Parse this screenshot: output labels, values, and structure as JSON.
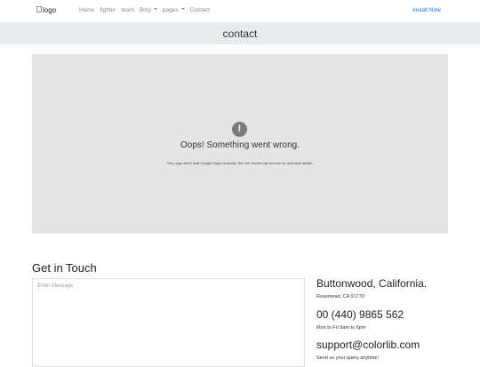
{
  "navbar": {
    "logo_alt": "logo",
    "items": [
      {
        "label": "Home"
      },
      {
        "label": "fighter"
      },
      {
        "label": "team"
      },
      {
        "label": "Blog",
        "dropdown": true
      },
      {
        "label": "pages",
        "dropdown": true
      },
      {
        "label": "Contact"
      }
    ],
    "install_label": "Install Now",
    "install_color": "#1a73e8"
  },
  "page_title": "contact",
  "map": {
    "error_icon": "exclamation-icon",
    "error_title": "Oops! Something went wrong.",
    "error_detail": "This page didn't load Google Maps correctly. See the JavaScript console for technical details."
  },
  "contact_form": {
    "heading": "Get in Touch",
    "message_placeholder": "Enter Message",
    "message_value": ""
  },
  "contact_info": {
    "address_main": "Buttonwood, California.",
    "address_sub": "Rosemead, CA 91770",
    "phone_main": "00 (440) 9865 562",
    "phone_sub": "Mon to Fri 9am to 6pm",
    "email_main": "support@colorlib.com",
    "email_sub": "Send us your query anytime!"
  }
}
